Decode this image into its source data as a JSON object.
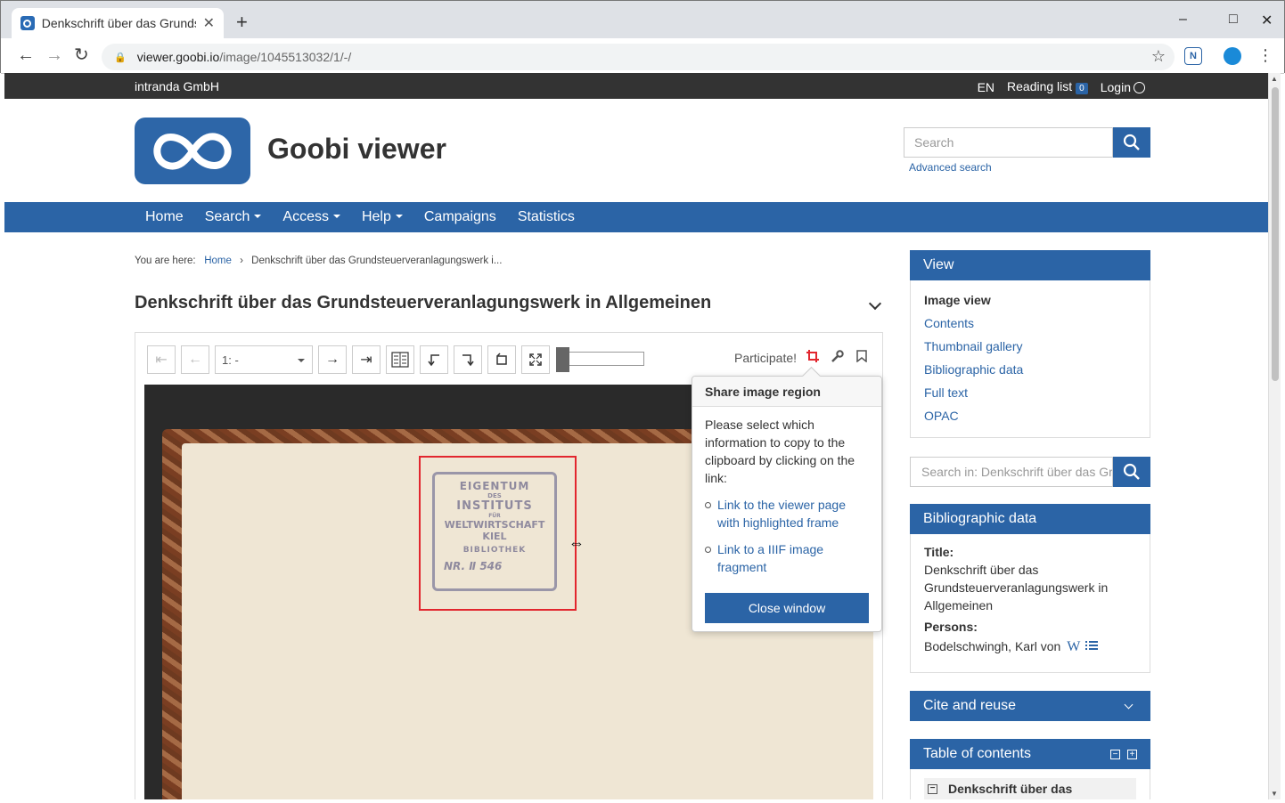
{
  "browser": {
    "tab_title": "Denkschrift über das Grundsteuerveranlagungswerk",
    "url_host": "viewer.goobi.io",
    "url_path": "/image/1045513032/1/-/",
    "new_tab": "+",
    "tab_close": "✕",
    "minimize": "–",
    "maximize": "□",
    "close": "✕",
    "back": "←",
    "forward": "→",
    "reload": "↻",
    "bookmark_star": "☆",
    "menu_dots": "⋮",
    "ext_label": "N"
  },
  "topbar": {
    "brand": "intranda GmbH",
    "language": "EN",
    "reading_list": "Reading list",
    "reading_list_count": "0",
    "login": "Login"
  },
  "header": {
    "site_title": "Goobi viewer",
    "search_placeholder": "Search",
    "advanced_search": "Advanced search"
  },
  "nav": {
    "items": [
      "Home",
      "Search",
      "Access",
      "Help",
      "Campaigns",
      "Statistics"
    ]
  },
  "breadcrumb": {
    "prefix": "You are here:",
    "home": "Home",
    "separator": "›",
    "current": "Denkschrift über das Grundsteuerveranlagungswerk i..."
  },
  "document": {
    "title": "Denkschrift über das Grundsteuerveranlagungswerk in Allgemeinen"
  },
  "viewer": {
    "first": "⇤",
    "prev": "←",
    "page_select": "1: -",
    "next": "→",
    "last": "⇥",
    "participate": "Participate!",
    "stamp_lines": [
      "EIGENTUM",
      "DES",
      "INSTITUTS",
      "FÜR",
      "WELTWIRTSCHAFT",
      "KIEL",
      "BIBLIOTHEK",
      "NR. Ⅱ 546"
    ]
  },
  "popover": {
    "title": "Share image region",
    "text": "Please select which information to copy to the clipboard by clicking on the link:",
    "links": [
      "Link to the viewer page with highlighted frame",
      "Link to a IIIF image fragment"
    ],
    "close": "Close window"
  },
  "sidebar": {
    "view": {
      "title": "View",
      "items": [
        "Image view",
        "Contents",
        "Thumbnail gallery",
        "Bibliographic data",
        "Full text",
        "OPAC"
      ]
    },
    "search_in_placeholder": "Search in: Denkschrift über das Grundsteuerveranlagungswerk",
    "bibliographic": {
      "title": "Bibliographic data",
      "title_label": "Title:",
      "title_value": "Denkschrift über das Grundsteuerveranlagungswerk in Allgemeinen",
      "persons_label": "Persons:",
      "persons_value": "Bodelschwingh, Karl von",
      "wiki_icon": "W"
    },
    "cite": {
      "title": "Cite and reuse"
    },
    "toc": {
      "title": "Table of contents",
      "entry": "Denkschrift über das"
    }
  },
  "colors": {
    "primary": "#2b64a6",
    "topbar": "#333333",
    "selection": "#e2262e"
  }
}
